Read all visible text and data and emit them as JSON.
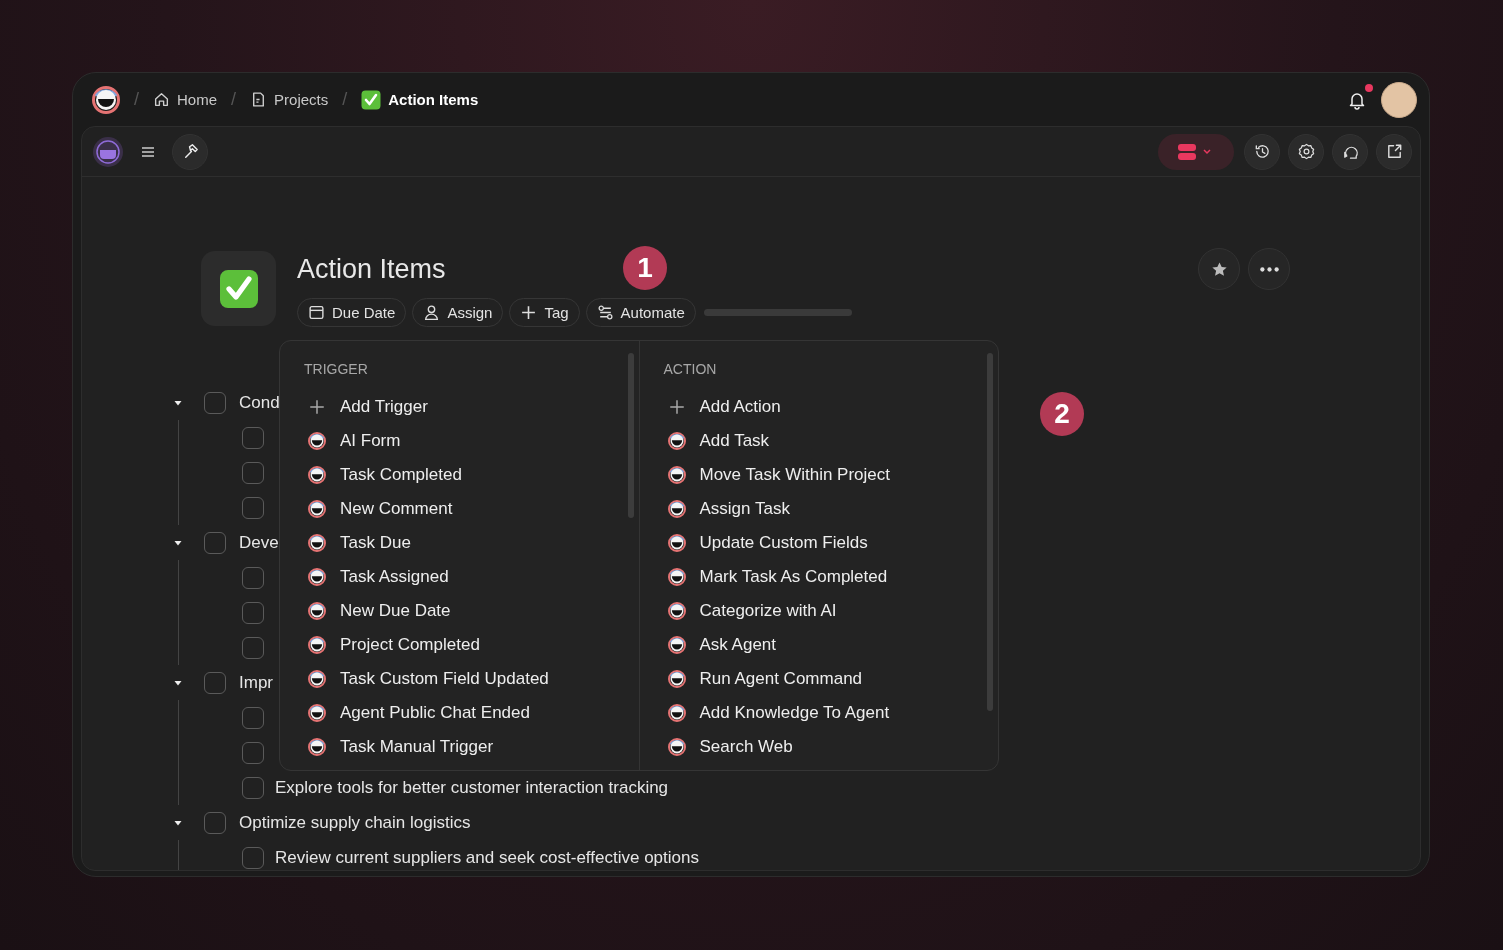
{
  "breadcrumbs": [
    {
      "separator": "/",
      "kind": "home",
      "label": "Home",
      "selected": false
    },
    {
      "separator": "/",
      "kind": "page",
      "label": "Projects",
      "selected": false
    },
    {
      "separator": "/",
      "kind": "check",
      "label": "Action Items",
      "selected": true
    }
  ],
  "notifications": {
    "unread": true
  },
  "page": {
    "title": "Action Items",
    "chips": [
      {
        "kind": "calendar",
        "label": "Due Date"
      },
      {
        "kind": "person",
        "label": "Assign"
      },
      {
        "kind": "plus",
        "label": "Tag"
      },
      {
        "kind": "automate",
        "label": "Automate"
      }
    ]
  },
  "tasks": [
    {
      "text": "Cond",
      "checked": false,
      "expanded": true,
      "children": [
        {
          "checked": false
        },
        {
          "checked": false
        },
        {
          "checked": false
        }
      ]
    },
    {
      "text": "Deve",
      "checked": false,
      "expanded": true,
      "children": [
        {
          "checked": false
        },
        {
          "checked": false
        },
        {
          "checked": false
        }
      ]
    },
    {
      "text": "Impr",
      "checked": false,
      "expanded": true,
      "children": [
        {
          "checked": false
        },
        {
          "checked": false
        },
        {
          "checked": false,
          "text": "Explore tools for better customer interaction tracking"
        }
      ]
    },
    {
      "text": "Optimize supply chain logistics",
      "checked": false,
      "expanded": true,
      "children": [
        {
          "checked": false,
          "text": "Review current suppliers and seek cost-effective options"
        }
      ]
    }
  ],
  "automate_menu": {
    "columns": [
      {
        "header": "TRIGGER",
        "add_label": "Add Trigger",
        "items": [
          "AI Form",
          "Task Completed",
          "New Comment",
          "Task Due",
          "Task Assigned",
          "New Due Date",
          "Project Completed",
          "Task Custom Field Updated",
          "Agent Public Chat Ended",
          "Task Manual Trigger"
        ]
      },
      {
        "header": "ACTION",
        "add_label": "Add Action",
        "items": [
          "Add Task",
          "Move Task Within Project",
          "Assign Task",
          "Update Custom Fields",
          "Mark Task As Completed",
          "Categorize with AI",
          "Ask Agent",
          "Run Agent Command",
          "Add Knowledge To Agent",
          "Search Web"
        ]
      }
    ]
  },
  "annotations": [
    "1",
    "2"
  ]
}
